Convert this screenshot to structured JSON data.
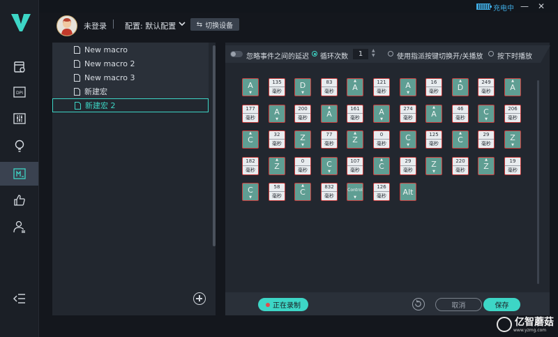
{
  "titlebar": {
    "charging": "充电中",
    "minimize": "—",
    "close": "✕"
  },
  "sidebar": {
    "items": [
      "macro-settings-icon",
      "dpi-icon",
      "eq-icon",
      "bulb-icon",
      "macro-icon",
      "thumbs-up-icon",
      "user-icon"
    ],
    "dpi_label": "DPI"
  },
  "header": {
    "user": "未登录",
    "config": "配置: 默认配置",
    "switch_device": "切换设备"
  },
  "macros": [
    "New macro",
    "New macro 2",
    "New macro 3",
    "新建宏",
    "新建宏 2"
  ],
  "options": {
    "ignore_delay": "忽略事件之间的延迟",
    "loop_count_label": "循环次数",
    "loop_count": "1",
    "toggle_play": "使用指派按键切换开/关播放",
    "hold_play": "按下时播放"
  },
  "events": [
    {
      "t": "key",
      "k": "A",
      "d": "down"
    },
    {
      "t": "delay",
      "v": "135"
    },
    {
      "t": "key",
      "k": "D",
      "d": "down"
    },
    {
      "t": "delay",
      "v": "83"
    },
    {
      "t": "key",
      "k": "A",
      "d": "up"
    },
    {
      "t": "delay",
      "v": "121"
    },
    {
      "t": "key",
      "k": "A",
      "d": "down"
    },
    {
      "t": "delay",
      "v": "16"
    },
    {
      "t": "key",
      "k": "D",
      "d": "up"
    },
    {
      "t": "delay",
      "v": "249"
    },
    {
      "t": "key",
      "k": "A",
      "d": "up"
    },
    {
      "t": "delay",
      "v": "177"
    },
    {
      "t": "key",
      "k": "A",
      "d": "down"
    },
    {
      "t": "delay",
      "v": "200"
    },
    {
      "t": "key",
      "k": "A",
      "d": "up"
    },
    {
      "t": "delay",
      "v": "161"
    },
    {
      "t": "key",
      "k": "A",
      "d": "down"
    },
    {
      "t": "delay",
      "v": "274"
    },
    {
      "t": "key",
      "k": "A",
      "d": "up"
    },
    {
      "t": "delay",
      "v": "46"
    },
    {
      "t": "key",
      "k": "C",
      "d": "down"
    },
    {
      "t": "delay",
      "v": "206"
    },
    {
      "t": "key",
      "k": "C",
      "d": "up"
    },
    {
      "t": "delay",
      "v": "32"
    },
    {
      "t": "key",
      "k": "Z",
      "d": "down"
    },
    {
      "t": "delay",
      "v": "77"
    },
    {
      "t": "key",
      "k": "Z",
      "d": "up"
    },
    {
      "t": "delay",
      "v": "0"
    },
    {
      "t": "key",
      "k": "C",
      "d": "down"
    },
    {
      "t": "delay",
      "v": "125"
    },
    {
      "t": "key",
      "k": "C",
      "d": "up"
    },
    {
      "t": "delay",
      "v": "29"
    },
    {
      "t": "key",
      "k": "Z",
      "d": "down"
    },
    {
      "t": "delay",
      "v": "182"
    },
    {
      "t": "key",
      "k": "Z",
      "d": "up"
    },
    {
      "t": "delay",
      "v": "0"
    },
    {
      "t": "key",
      "k": "C",
      "d": "down"
    },
    {
      "t": "delay",
      "v": "107"
    },
    {
      "t": "key",
      "k": "C",
      "d": "up"
    },
    {
      "t": "delay",
      "v": "29"
    },
    {
      "t": "key",
      "k": "Z",
      "d": "down"
    },
    {
      "t": "delay",
      "v": "220"
    },
    {
      "t": "key",
      "k": "Z",
      "d": "up"
    },
    {
      "t": "delay",
      "v": "19"
    },
    {
      "t": "key",
      "k": "C",
      "d": "down"
    },
    {
      "t": "delay",
      "v": "58"
    },
    {
      "t": "key",
      "k": "C",
      "d": "up"
    },
    {
      "t": "delay",
      "v": "832"
    },
    {
      "t": "key",
      "k": "Control",
      "d": "down"
    },
    {
      "t": "delay",
      "v": "126"
    },
    {
      "t": "key",
      "k": "Alt",
      "d": "none"
    }
  ],
  "delay_unit": "毫秒",
  "bottom": {
    "record": "正在录制",
    "cancel": "取消",
    "save": "保存"
  },
  "watermark": {
    "name": "亿智蘑菇",
    "url": "www.yzmg.com"
  }
}
